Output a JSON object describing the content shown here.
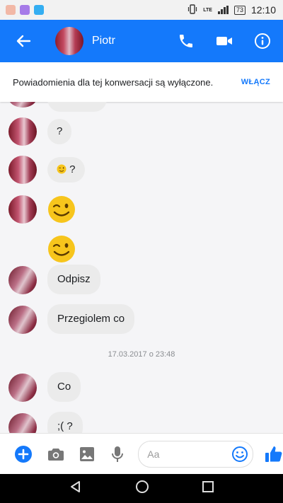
{
  "status_bar": {
    "network": "LTE",
    "battery": "73",
    "time": "12:10"
  },
  "header": {
    "contact_name": "Piotr"
  },
  "notice": {
    "text": "Powiadomienia dla tej konwersacji są wyłączone.",
    "action": "WŁĄCZ"
  },
  "messages": [
    {
      "text": "?"
    },
    {
      "text": "?"
    },
    {
      "emoji": "wink"
    },
    {
      "emoji": "wink"
    },
    {
      "text": "Odpisz"
    },
    {
      "text": "Przegiolem co"
    },
    {
      "timestamp": "17.03.2017 o 23:48"
    },
    {
      "text": "Co"
    },
    {
      "text": ";( ?"
    }
  ],
  "composer": {
    "placeholder": "Aa"
  },
  "colors": {
    "accent": "#1479fb",
    "bubble": "#ebebeb",
    "emoji": "#f7c51c"
  }
}
